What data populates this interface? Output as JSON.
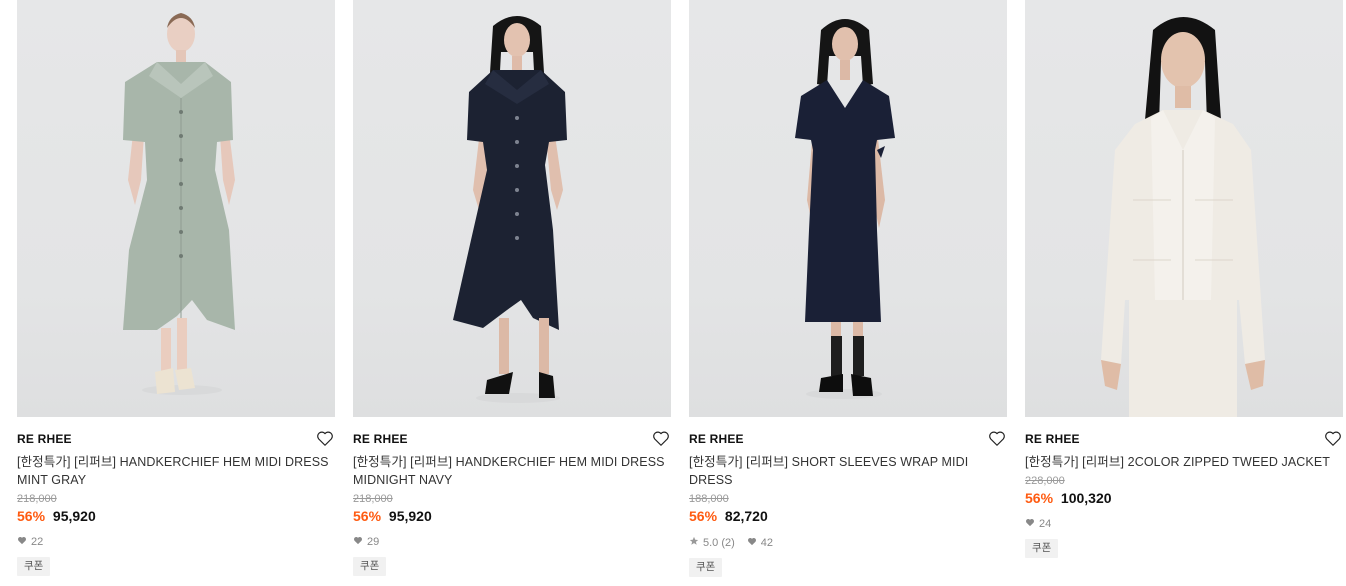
{
  "products": [
    {
      "brand": "RE RHEE",
      "title": "[한정특가] [리퍼브] HANDKERCHIEF HEM MIDI DRESS MINT GRAY",
      "original_price": "218,000",
      "discount": "56%",
      "price": "95,920",
      "rating": "",
      "likes": "22",
      "coupon": "쿠폰",
      "garment_color": "#a8b6aa",
      "heart_icon": "heart-outline-icon"
    },
    {
      "brand": "RE RHEE",
      "title": "[한정특가] [리퍼브] HANDKERCHIEF HEM MIDI DRESS MIDNIGHT NAVY",
      "original_price": "218,000",
      "discount": "56%",
      "price": "95,920",
      "rating": "",
      "likes": "29",
      "coupon": "쿠폰",
      "garment_color": "#1c2232",
      "heart_icon": "heart-outline-icon"
    },
    {
      "brand": "RE RHEE",
      "title": "[한정특가] [리퍼브] SHORT SLEEVES WRAP MIDI DRESS",
      "original_price": "188,000",
      "discount": "56%",
      "price": "82,720",
      "rating": "5.0 (2)",
      "likes": "42",
      "coupon": "쿠폰",
      "garment_color": "#1a2036",
      "heart_icon": "heart-outline-icon"
    },
    {
      "brand": "RE RHEE",
      "title": "[한정특가] [리퍼브] 2COLOR ZIPPED TWEED JACKET",
      "original_price": "228,000",
      "discount": "56%",
      "price": "100,320",
      "rating": "",
      "likes": "24",
      "coupon": "쿠폰",
      "garment_color": "#efebe4",
      "heart_icon": "heart-outline-icon"
    }
  ],
  "colors": {
    "discount": "#ff5b11",
    "original_price": "#9a9a9a",
    "coupon_bg": "#f1f1f1"
  }
}
